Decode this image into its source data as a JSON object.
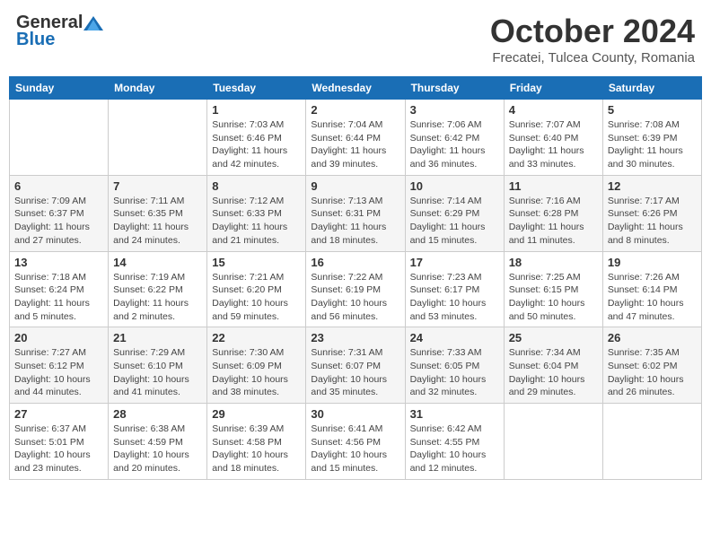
{
  "header": {
    "logo_general": "General",
    "logo_blue": "Blue",
    "month_title": "October 2024",
    "subtitle": "Frecatei, Tulcea County, Romania"
  },
  "weekdays": [
    "Sunday",
    "Monday",
    "Tuesday",
    "Wednesday",
    "Thursday",
    "Friday",
    "Saturday"
  ],
  "weeks": [
    [
      {
        "day": "",
        "info": ""
      },
      {
        "day": "",
        "info": ""
      },
      {
        "day": "1",
        "info": "Sunrise: 7:03 AM\nSunset: 6:46 PM\nDaylight: 11 hours and 42 minutes."
      },
      {
        "day": "2",
        "info": "Sunrise: 7:04 AM\nSunset: 6:44 PM\nDaylight: 11 hours and 39 minutes."
      },
      {
        "day": "3",
        "info": "Sunrise: 7:06 AM\nSunset: 6:42 PM\nDaylight: 11 hours and 36 minutes."
      },
      {
        "day": "4",
        "info": "Sunrise: 7:07 AM\nSunset: 6:40 PM\nDaylight: 11 hours and 33 minutes."
      },
      {
        "day": "5",
        "info": "Sunrise: 7:08 AM\nSunset: 6:39 PM\nDaylight: 11 hours and 30 minutes."
      }
    ],
    [
      {
        "day": "6",
        "info": "Sunrise: 7:09 AM\nSunset: 6:37 PM\nDaylight: 11 hours and 27 minutes."
      },
      {
        "day": "7",
        "info": "Sunrise: 7:11 AM\nSunset: 6:35 PM\nDaylight: 11 hours and 24 minutes."
      },
      {
        "day": "8",
        "info": "Sunrise: 7:12 AM\nSunset: 6:33 PM\nDaylight: 11 hours and 21 minutes."
      },
      {
        "day": "9",
        "info": "Sunrise: 7:13 AM\nSunset: 6:31 PM\nDaylight: 11 hours and 18 minutes."
      },
      {
        "day": "10",
        "info": "Sunrise: 7:14 AM\nSunset: 6:29 PM\nDaylight: 11 hours and 15 minutes."
      },
      {
        "day": "11",
        "info": "Sunrise: 7:16 AM\nSunset: 6:28 PM\nDaylight: 11 hours and 11 minutes."
      },
      {
        "day": "12",
        "info": "Sunrise: 7:17 AM\nSunset: 6:26 PM\nDaylight: 11 hours and 8 minutes."
      }
    ],
    [
      {
        "day": "13",
        "info": "Sunrise: 7:18 AM\nSunset: 6:24 PM\nDaylight: 11 hours and 5 minutes."
      },
      {
        "day": "14",
        "info": "Sunrise: 7:19 AM\nSunset: 6:22 PM\nDaylight: 11 hours and 2 minutes."
      },
      {
        "day": "15",
        "info": "Sunrise: 7:21 AM\nSunset: 6:20 PM\nDaylight: 10 hours and 59 minutes."
      },
      {
        "day": "16",
        "info": "Sunrise: 7:22 AM\nSunset: 6:19 PM\nDaylight: 10 hours and 56 minutes."
      },
      {
        "day": "17",
        "info": "Sunrise: 7:23 AM\nSunset: 6:17 PM\nDaylight: 10 hours and 53 minutes."
      },
      {
        "day": "18",
        "info": "Sunrise: 7:25 AM\nSunset: 6:15 PM\nDaylight: 10 hours and 50 minutes."
      },
      {
        "day": "19",
        "info": "Sunrise: 7:26 AM\nSunset: 6:14 PM\nDaylight: 10 hours and 47 minutes."
      }
    ],
    [
      {
        "day": "20",
        "info": "Sunrise: 7:27 AM\nSunset: 6:12 PM\nDaylight: 10 hours and 44 minutes."
      },
      {
        "day": "21",
        "info": "Sunrise: 7:29 AM\nSunset: 6:10 PM\nDaylight: 10 hours and 41 minutes."
      },
      {
        "day": "22",
        "info": "Sunrise: 7:30 AM\nSunset: 6:09 PM\nDaylight: 10 hours and 38 minutes."
      },
      {
        "day": "23",
        "info": "Sunrise: 7:31 AM\nSunset: 6:07 PM\nDaylight: 10 hours and 35 minutes."
      },
      {
        "day": "24",
        "info": "Sunrise: 7:33 AM\nSunset: 6:05 PM\nDaylight: 10 hours and 32 minutes."
      },
      {
        "day": "25",
        "info": "Sunrise: 7:34 AM\nSunset: 6:04 PM\nDaylight: 10 hours and 29 minutes."
      },
      {
        "day": "26",
        "info": "Sunrise: 7:35 AM\nSunset: 6:02 PM\nDaylight: 10 hours and 26 minutes."
      }
    ],
    [
      {
        "day": "27",
        "info": "Sunrise: 6:37 AM\nSunset: 5:01 PM\nDaylight: 10 hours and 23 minutes."
      },
      {
        "day": "28",
        "info": "Sunrise: 6:38 AM\nSunset: 4:59 PM\nDaylight: 10 hours and 20 minutes."
      },
      {
        "day": "29",
        "info": "Sunrise: 6:39 AM\nSunset: 4:58 PM\nDaylight: 10 hours and 18 minutes."
      },
      {
        "day": "30",
        "info": "Sunrise: 6:41 AM\nSunset: 4:56 PM\nDaylight: 10 hours and 15 minutes."
      },
      {
        "day": "31",
        "info": "Sunrise: 6:42 AM\nSunset: 4:55 PM\nDaylight: 10 hours and 12 minutes."
      },
      {
        "day": "",
        "info": ""
      },
      {
        "day": "",
        "info": ""
      }
    ]
  ]
}
